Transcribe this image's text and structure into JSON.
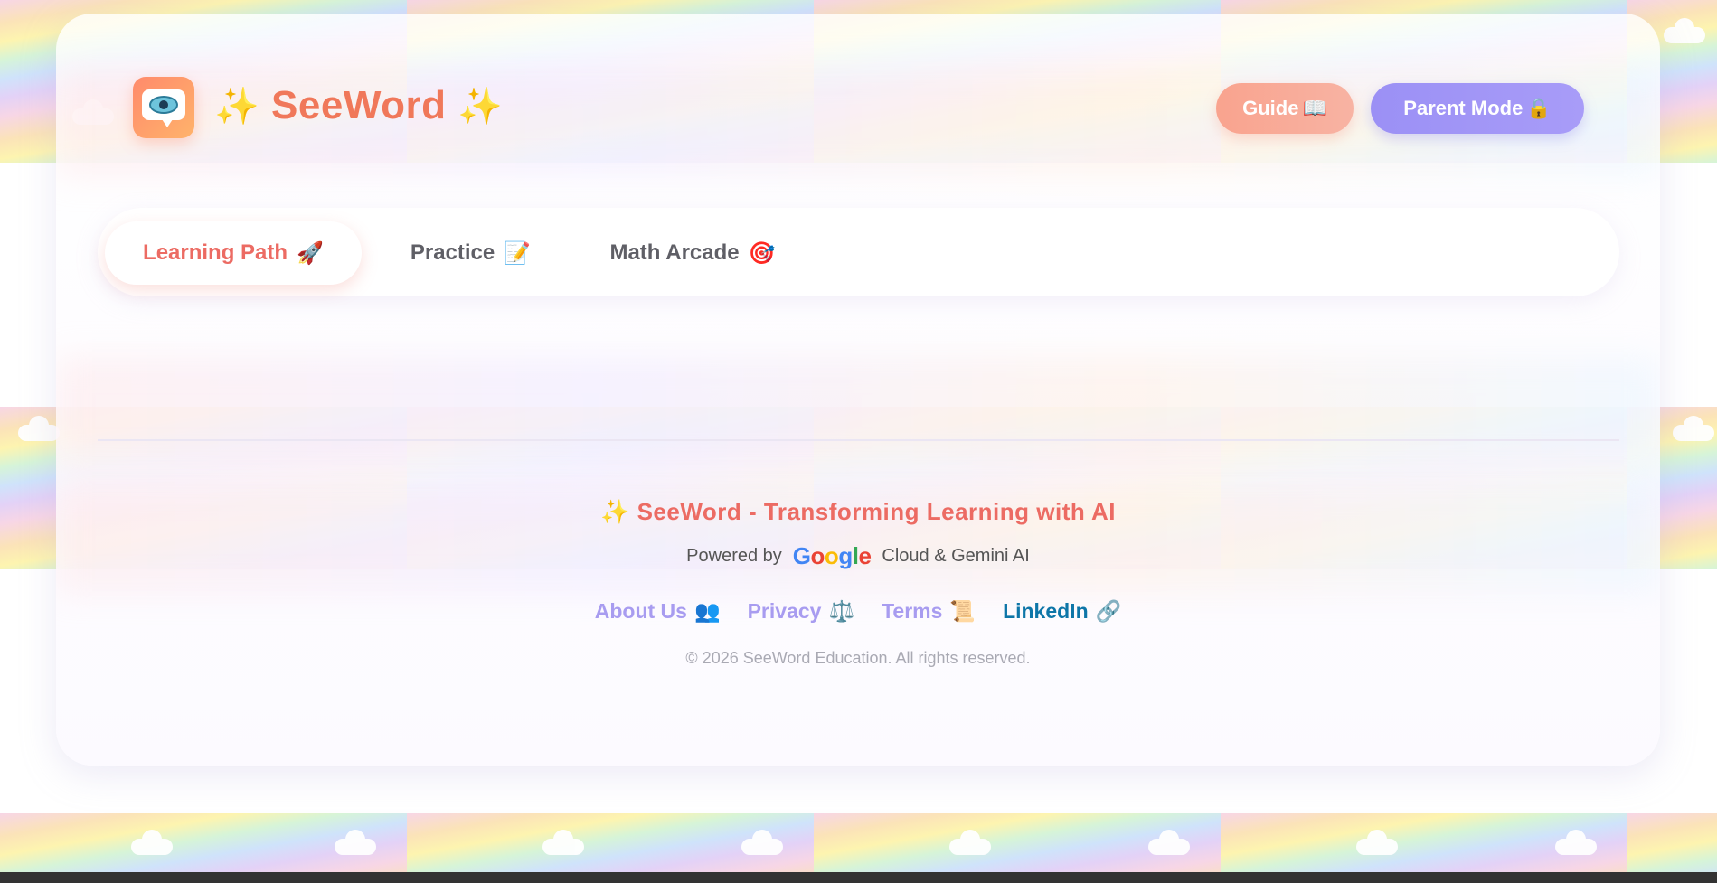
{
  "header": {
    "brand_sparkle_left": "✨",
    "brand_name": "SeeWord",
    "brand_sparkle_right": "✨",
    "logo_icon": "eye-speech-bubble-icon",
    "guide_label": "Guide",
    "guide_icon": "📖",
    "parent_label": "Parent Mode",
    "parent_icon": "🔒"
  },
  "tabs": [
    {
      "label": "Learning Path",
      "icon": "🚀",
      "active": true
    },
    {
      "label": "Practice",
      "icon": "📝",
      "active": false
    },
    {
      "label": "Math Arcade",
      "icon": "🎯",
      "active": false
    }
  ],
  "footer": {
    "title_icon": "✨",
    "title": "SeeWord - Transforming Learning with AI",
    "powered_prefix": "Powered by",
    "google": [
      "G",
      "o",
      "o",
      "g",
      "l",
      "e"
    ],
    "powered_suffix": "Cloud & Gemini AI",
    "links": [
      {
        "label": "About Us",
        "icon": "👥"
      },
      {
        "label": "Privacy",
        "icon": "⚖️"
      },
      {
        "label": "Terms",
        "icon": "📜"
      },
      {
        "label": "LinkedIn",
        "icon": "🔗"
      }
    ],
    "copyright": "© 2026 SeeWord Education. All rights reserved."
  },
  "colors": {
    "brand": "#f0785a",
    "accent_red": "#ec6b63",
    "accent_purple": "#a89cf0",
    "linkedin_blue": "#0e76a8",
    "guide_button": "#f9a38e",
    "parent_button": "#9b90f5"
  }
}
